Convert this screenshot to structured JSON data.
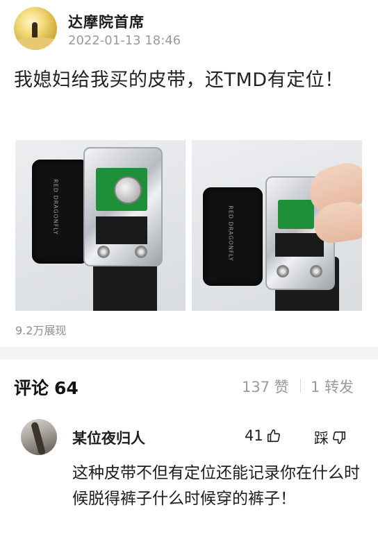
{
  "post": {
    "author": "达摩院首席",
    "time": "2022-01-13 18:46",
    "text": "我媳妇给我买的皮带，还TMD有定位！",
    "photo_engraving": "RED DRAGONFLY",
    "views": "9.2万展现"
  },
  "comments_header": {
    "label": "评论",
    "count": "64",
    "likes": "137 赞",
    "shares": "1 转发"
  },
  "comment": {
    "user": "某位夜归人",
    "likes": "41",
    "dislike_label": "踩",
    "text": "这种皮带不但有定位还能记录你在什么时候脱得裤子什么时候穿的裤子！"
  },
  "icons": [
    "avatar-image",
    "thumb-up-icon",
    "thumb-down-icon"
  ]
}
